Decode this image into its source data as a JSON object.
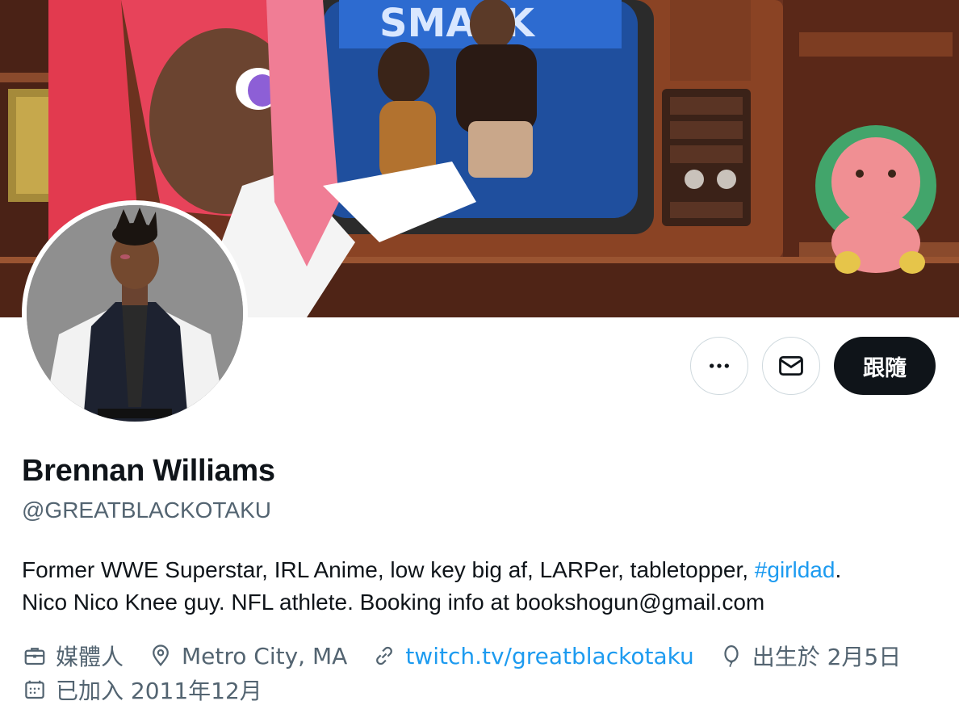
{
  "profile": {
    "name": "Brennan Williams",
    "handle": "@GREATBLACKOTAKU",
    "bio_part1": "Former WWE Superstar, IRL Anime, low key big af, LARPer, tabletopper, ",
    "bio_hashtag": "#girldad",
    "bio_part2": ".",
    "bio_line2": "Nico Nico Knee guy. NFL athlete. Booking info at bookshogun@gmail.com"
  },
  "actions": {
    "more_icon": "more-icon",
    "message_icon": "envelope-icon",
    "follow_label": "跟隨"
  },
  "meta": {
    "profession": "媒體人",
    "location": "Metro City, MA",
    "website": "twitch.tv/greatblackotaku",
    "birthday": "出生於 2月5日",
    "joined": "已加入 2011年12月"
  },
  "colors": {
    "accent": "#1d9bf0",
    "text_primary": "#0f1419",
    "text_secondary": "#536471",
    "follow_bg": "#0f1419"
  }
}
